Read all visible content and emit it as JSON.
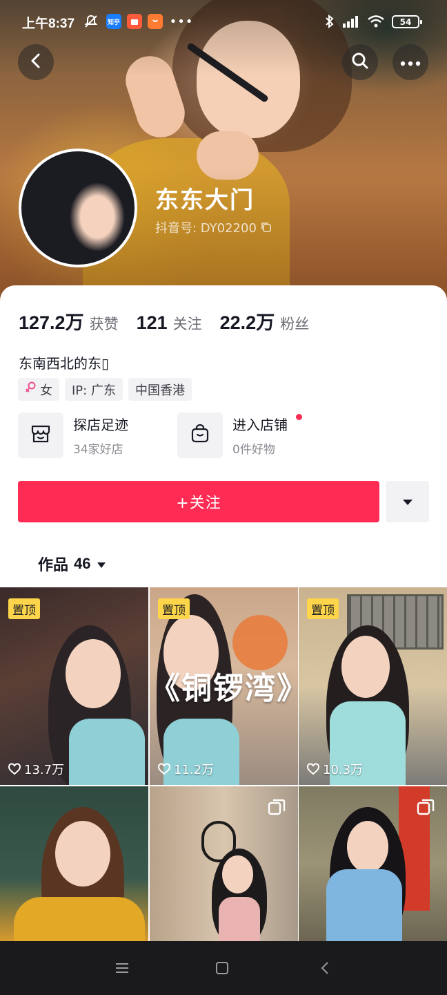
{
  "status_bar": {
    "time": "上午8:37",
    "zhihu_label": "知乎",
    "battery": "54"
  },
  "profile": {
    "name": "东东大门",
    "douyin_id": "抖音号: DY02200",
    "bio": "东南西北的东▯"
  },
  "stats": [
    {
      "value": "127.2万",
      "label": "获赞"
    },
    {
      "value": "121",
      "label": "关注"
    },
    {
      "value": "22.2万",
      "label": "粉丝"
    }
  ],
  "tags": {
    "gender": "女",
    "ip": "IP: 广东",
    "region": "中国香港"
  },
  "features": {
    "explore_title": "探店足迹",
    "explore_sub": "34家好店",
    "shop_title": "进入店铺",
    "shop_sub": "0件好物"
  },
  "actions": {
    "follow_label": "+关注"
  },
  "works_tab": {
    "label": "作品",
    "count": "46"
  },
  "videos": [
    {
      "pinned_label": "置顶",
      "likes": "13.7万"
    },
    {
      "pinned_label": "置顶",
      "likes": "11.2万",
      "caption": "《铜锣湾》"
    },
    {
      "pinned_label": "置顶",
      "likes": "10.3万"
    },
    {
      "is_gallery": true
    },
    {
      "is_gallery": true
    },
    {
      "is_gallery": true
    }
  ],
  "colors": {
    "brand_red": "#fe2c55",
    "pin_badge": "#fcd54a"
  },
  "icons": [
    "back-icon",
    "search-icon",
    "more-icon",
    "copy-icon",
    "female-icon",
    "store-icon",
    "shop-bag-icon",
    "caret-down-icon",
    "heart-icon",
    "gallery-icon",
    "menu-icon",
    "home-icon",
    "nav-back-icon"
  ]
}
